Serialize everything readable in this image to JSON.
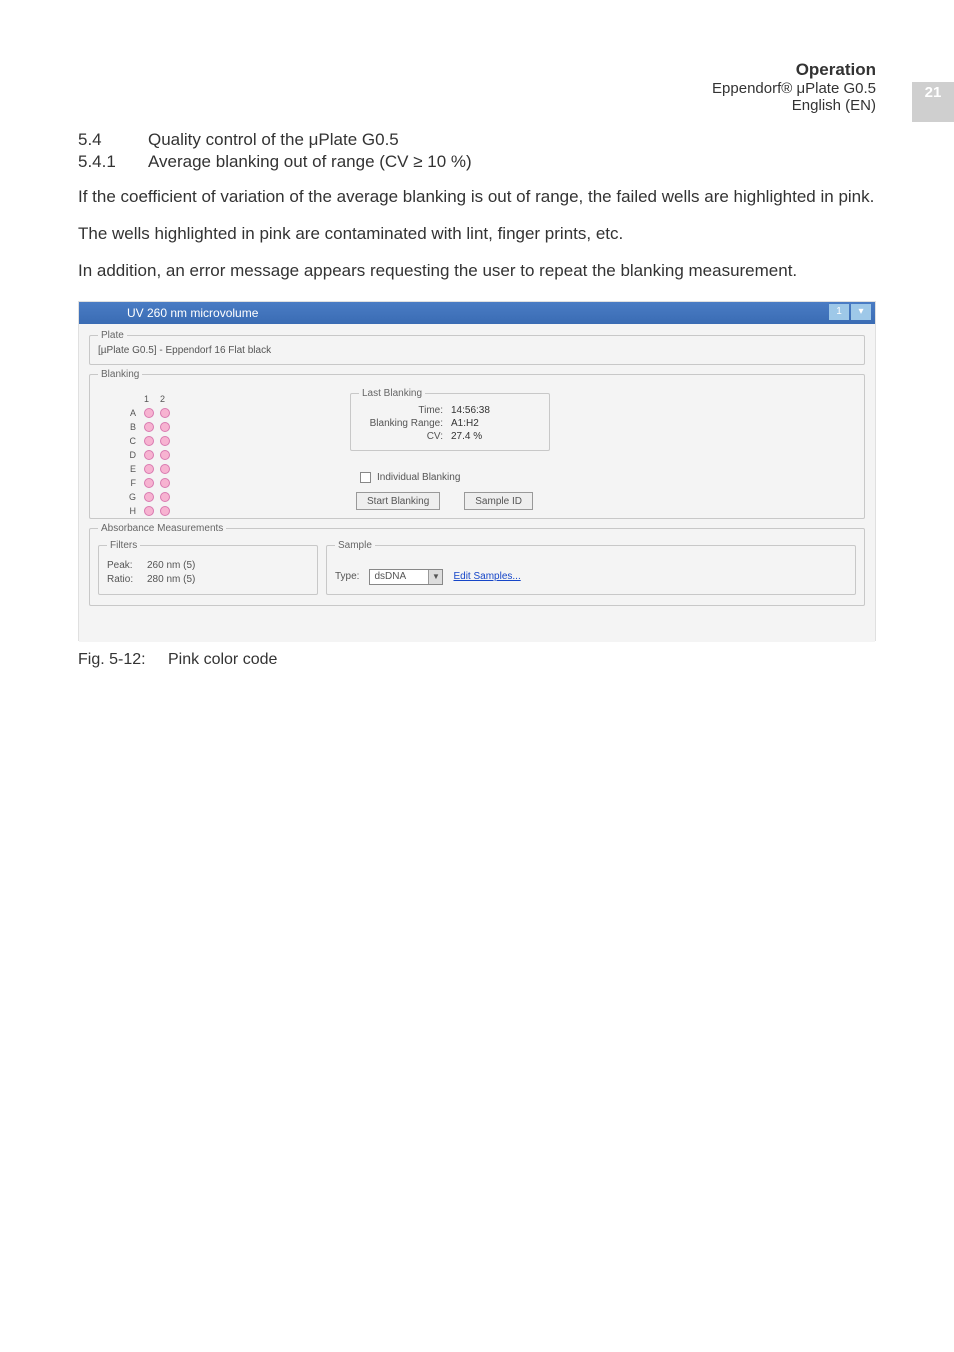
{
  "header": {
    "title": "Operation",
    "product": "Eppendorf® μPlate G0.5",
    "language": "English (EN)",
    "page_number": "21"
  },
  "sections": {
    "num1": "5.4",
    "text1": "Quality control of the μPlate G0.5",
    "num2": "5.4.1",
    "text2": "Average blanking out of range (CV ≥ 10 %)"
  },
  "paragraphs": {
    "p1": "If the coefficient of variation of the average blanking is out of range, the failed wells are highlighted in pink.",
    "p2": "The wells highlighted in pink are contaminated with lint, finger prints, etc.",
    "p3": "In addition, an error message appears requesting the user to repeat the blanking measurement."
  },
  "screenshot": {
    "window_title": "UV 260 nm microvolume",
    "badge": "1",
    "plate_legend": "Plate",
    "plate_value": "[µPlate G0.5] - Eppendorf 16 Flat black",
    "blanking_legend": "Blanking",
    "columns": {
      "c1": "1",
      "c2": "2"
    },
    "rows": {
      "A": {
        "label": "A",
        "w1": "pink",
        "w2": "pink"
      },
      "B": {
        "label": "B",
        "w1": "pink",
        "w2": "pink"
      },
      "C": {
        "label": "C",
        "w1": "pink",
        "w2": "pink"
      },
      "D": {
        "label": "D",
        "w1": "pink",
        "w2": "pink"
      },
      "E": {
        "label": "E",
        "w1": "pink",
        "w2": "pink"
      },
      "F": {
        "label": "F",
        "w1": "pink",
        "w2": "pink"
      },
      "G": {
        "label": "G",
        "w1": "pink",
        "w2": "pink"
      },
      "H": {
        "label": "H",
        "w1": "pink",
        "w2": "pink"
      }
    },
    "last_blanking": {
      "legend": "Last Blanking",
      "time_key": "Time:",
      "time_val": "14:56:38",
      "range_key": "Blanking Range:",
      "range_val": "A1:H2",
      "cv_key": "CV:",
      "cv_val": "27.4 %"
    },
    "individual_blanking_label": "Individual Blanking",
    "start_blanking_btn": "Start Blanking",
    "sample_id_btn": "Sample ID",
    "absorbance_legend": "Absorbance Measurements",
    "filters": {
      "legend": "Filters",
      "peak_key": "Peak:",
      "peak_val": "260 nm (5)",
      "ratio_key": "Ratio:",
      "ratio_val": "280 nm (5)"
    },
    "sample": {
      "legend": "Sample",
      "type_key": "Type:",
      "type_val": "dsDNA",
      "edit_link": "Edit Samples..."
    }
  },
  "figure": {
    "num": "Fig. 5-12:",
    "caption": "Pink color code"
  }
}
